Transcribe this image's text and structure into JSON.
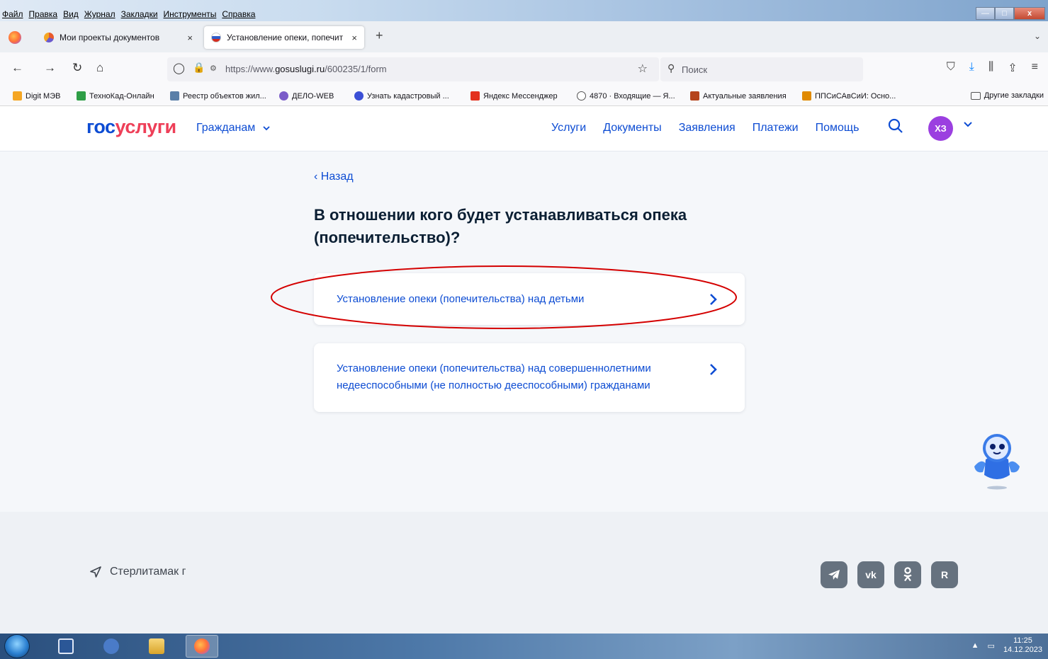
{
  "os_menu": {
    "items": [
      "Файл",
      "Правка",
      "Вид",
      "Журнал",
      "Закладки",
      "Инструменты",
      "Справка"
    ],
    "window_controls": [
      "—",
      "□",
      "x"
    ]
  },
  "tabs": [
    {
      "title": "Мои проекты документов",
      "close": "×"
    },
    {
      "title": "Установление опеки, попечит",
      "close": "×"
    }
  ],
  "new_tab": "+",
  "tab_list_arrow": "⌄",
  "urlbar": {
    "url_prefix": "https://www.",
    "url_domain": "gosuslugi.ru",
    "url_path": "/600235/1/form"
  },
  "searchbar": {
    "placeholder": "Поиск"
  },
  "bookmarks": [
    {
      "label": "Digit МЭВ",
      "color": "#f5a623"
    },
    {
      "label": "ТехноКад-Онлайн",
      "color": "#2e9e46"
    },
    {
      "label": "Реестр объектов жил...",
      "color": "#5a7fa8"
    },
    {
      "label": "ДЕЛО-WEB",
      "color": "#7b5cc9"
    },
    {
      "label": "Узнать кадастровый ...",
      "color": "#3b4fd6"
    },
    {
      "label": "Яндекс Мессенджер",
      "color": "#e3311d"
    },
    {
      "label": "4870 · Входящие — Я...",
      "color": "#555555"
    },
    {
      "label": "Актуальные заявления",
      "color": "#b5441b"
    },
    {
      "label": "ППСиСАвСиИ: Осно...",
      "color": "#e08a00"
    }
  ],
  "bookmarks_other": "Другие закладки",
  "site": {
    "logo_part1": "гос",
    "logo_part2": "услуги",
    "audience": "Гражданам",
    "nav": [
      "Услуги",
      "Документы",
      "Заявления",
      "Платежи",
      "Помощь"
    ],
    "avatar_initials": "ХЗ",
    "brand_blue": "#0d4cd3",
    "brand_red": "#ee3f58"
  },
  "main": {
    "back": "Назад",
    "question": "В отношении кого будет устанавливаться опека (попечительство)?",
    "options": [
      "Установление опеки (попечительства) над детьми",
      "Установление опеки (попечительства) над совершеннолетними недееспособными (не полностью дееспособными) гражданами"
    ],
    "highlight_color": "#d40000"
  },
  "footer": {
    "location": "Стерлитамак г",
    "socials": [
      "telegram-icon",
      "vk-icon",
      "ok-icon",
      "rutube-icon"
    ],
    "social_labels": {
      "vk": "vk",
      "rutube": "R"
    }
  },
  "taskbar": {
    "time": "11:25",
    "date": "14.12.2023"
  }
}
